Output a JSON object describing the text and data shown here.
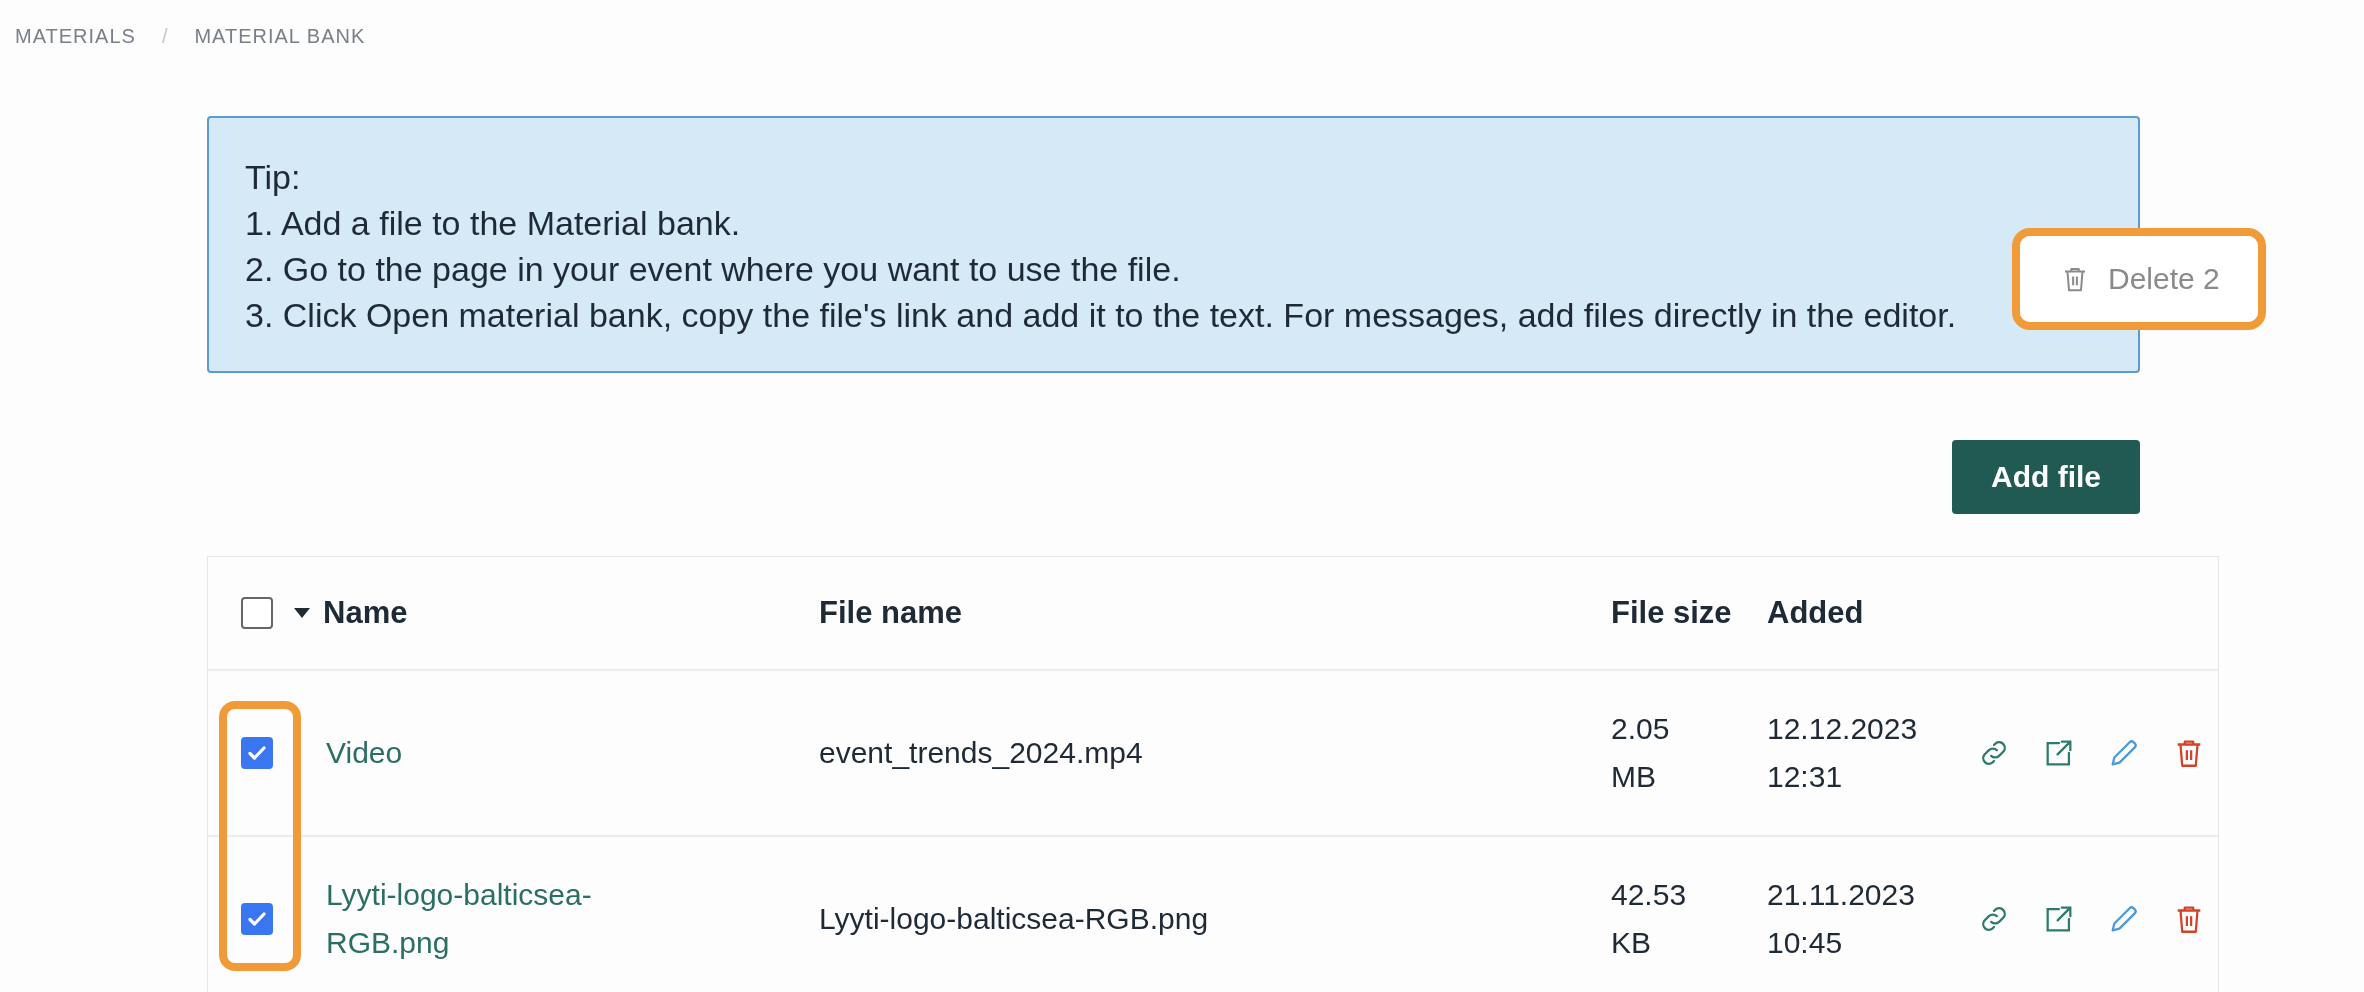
{
  "breadcrumb": {
    "items": [
      {
        "label": "MATERIALS"
      },
      {
        "label": "MATERIAL BANK"
      }
    ],
    "separator": "/"
  },
  "tip": {
    "lines": [
      "Tip:",
      "1. Add a file to the Material bank.",
      "2. Go to the page in your event where you want to use the file.",
      "3. Click Open material bank, copy the file's link and add it to the text. For messages, add files directly in the editor."
    ]
  },
  "delete_button": {
    "label": "Delete 2",
    "disabled": true
  },
  "add_file_button": {
    "label": "Add file"
  },
  "table": {
    "select_all": {
      "checked": false
    },
    "columns": [
      {
        "label": "Name",
        "sorted": true
      },
      {
        "label": "File name",
        "sorted": false
      },
      {
        "label": "File size",
        "sorted": false
      },
      {
        "label": "Added",
        "sorted": false
      }
    ],
    "rows": [
      {
        "checked": true,
        "name": "Video",
        "file_name": "event_trends_2024.mp4",
        "file_size": "2.05 MB",
        "added": "12.12.2023 12:31"
      },
      {
        "checked": true,
        "name": "Lyyti-logo-balticsea-RGB.png",
        "file_name": "Lyyti-logo-balticsea-RGB.png",
        "file_size": "42.53 KB",
        "added": "21.11.2023 10:45"
      }
    ]
  }
}
